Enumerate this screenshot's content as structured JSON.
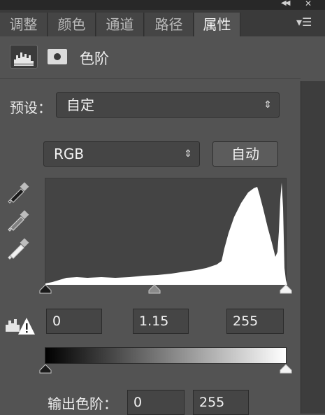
{
  "window": {
    "collapse_icon": "double-chevron-right-icon",
    "close_icon": "close-icon"
  },
  "tabs": [
    {
      "label": "调整",
      "active": false
    },
    {
      "label": "颜色",
      "active": false
    },
    {
      "label": "通道",
      "active": false
    },
    {
      "label": "路径",
      "active": false
    },
    {
      "label": "属性",
      "active": true
    }
  ],
  "panel": {
    "title": "色阶",
    "icons": [
      "levels-adjustment-icon",
      "layer-mask-icon"
    ]
  },
  "preset": {
    "label": "预设：",
    "value": "自定"
  },
  "channel": {
    "value": "RGB",
    "auto_label": "自动"
  },
  "eyedroppers": [
    "black-point-eyedropper-icon",
    "gray-point-eyedropper-icon",
    "white-point-eyedropper-icon"
  ],
  "input_levels": {
    "black": "0",
    "gamma": "1.15",
    "white": "255"
  },
  "output_levels": {
    "label": "输出色阶：",
    "black": "0",
    "white": "255"
  },
  "colors": {
    "panel_bg": "#535353",
    "tab_active": "#535353",
    "tab_inactive": "#454545",
    "histogram": "#ffffff"
  }
}
